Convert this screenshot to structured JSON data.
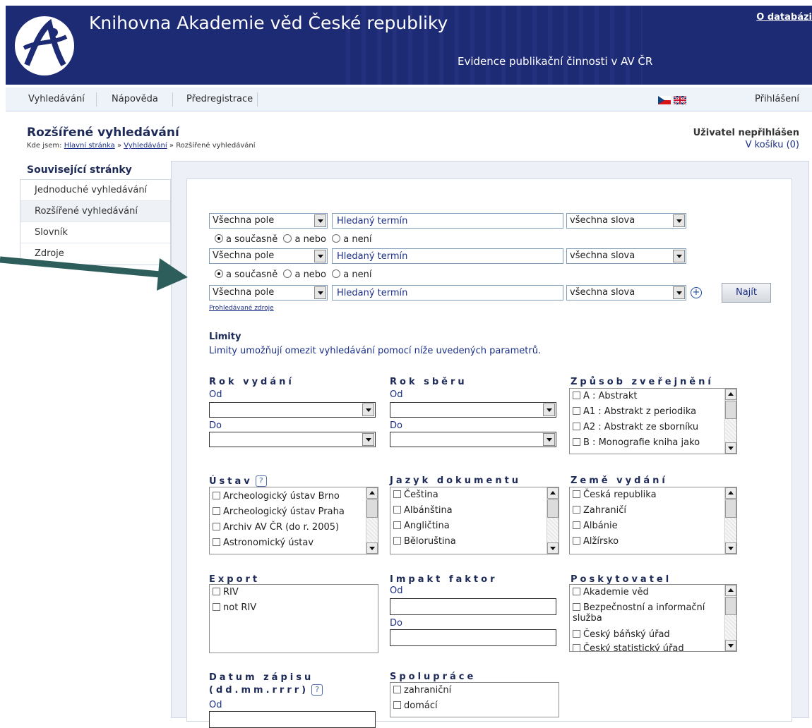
{
  "header": {
    "site_title": "Knihovna Akademie věd České republiky",
    "subtitle": "Evidence publikační činnosti v AV ČR",
    "about_link": "O databázi"
  },
  "nav": {
    "items": [
      "Vyhledávání",
      "Nápověda",
      "Předregistrace"
    ],
    "login": "Přihlášení"
  },
  "page": {
    "title": "Rozšířené vyhledávání",
    "crumb_prefix": "Kde jsem:",
    "crumb_home": "Hlavní stránka",
    "crumb_sep": "»",
    "crumb_search": "Vyhledávání",
    "crumb_current": "Rozšířené vyhledávání",
    "user_status": "Uživatel nepřihlášen",
    "cart": "V košíku (0)"
  },
  "sidebar": {
    "title": "Související stránky",
    "items": [
      "Jednoduché vyhledávání",
      "Rozšířené vyhledávání",
      "Slovník",
      "Zdroje"
    ]
  },
  "search": {
    "field_select": "Všechna pole",
    "term_placeholder": "Hledaný termín",
    "mode_select": "všechna slova",
    "ops": [
      "a současně",
      "a nebo",
      "a není"
    ],
    "find_button": "Najít",
    "sources_link": "Prohledávané zdroje"
  },
  "limits": {
    "title": "Limity",
    "description": "Limity umožňují omezit vyhledávání pomocí níže uvedených parametrů.",
    "from": "Od",
    "to": "Do",
    "rok_vydani": "Rok vydání",
    "rok_sberu": "Rok sběru",
    "zpusob": "Způsob zveřejnění",
    "zpusob_items": [
      "A : Abstrakt",
      "A1 : Abstrakt z periodika",
      "A2 : Abstrakt ze sborníku",
      "B : Monografie kniha jako"
    ],
    "ustav": "Ústav",
    "ustav_items": [
      "Archeologický ústav Brno",
      "Archeologický ústav Praha",
      "Archiv AV ČR (do r. 2005)",
      "Astronomický ústav"
    ],
    "jazyk": "Jazyk dokumentu",
    "jazyk_items": [
      "Čeština",
      "Albánština",
      "Angličtina",
      "Běloruština"
    ],
    "zeme": "Země vydání",
    "zeme_items": [
      "Česká republika",
      "Zahraničí",
      "Albánie",
      "Alžírsko"
    ],
    "export": "Export",
    "export_items": [
      "RIV",
      "not RIV"
    ],
    "impakt": "Impakt faktor",
    "poskytovatel": "Poskytovatel",
    "poskytovatel_items": [
      "Akademie věd",
      "Bezpečnostní a informační služba",
      "Český báňský úřad",
      "Český statistický úřad"
    ],
    "datum": "Datum zápisu (dd.mm.rrrr)",
    "spoluprace": "Spolupráce",
    "spoluprace_items": [
      "zahraniční",
      "domácí"
    ]
  },
  "colors": {
    "header_bg": "#1d2a74",
    "arrow": "#2e5e5c",
    "link": "#1b2f86"
  },
  "icons": [
    "akademie-logo-icon",
    "czech-flag-icon",
    "uk-flag-icon",
    "help-icon",
    "plus-icon",
    "arrow-annotation-icon"
  ]
}
